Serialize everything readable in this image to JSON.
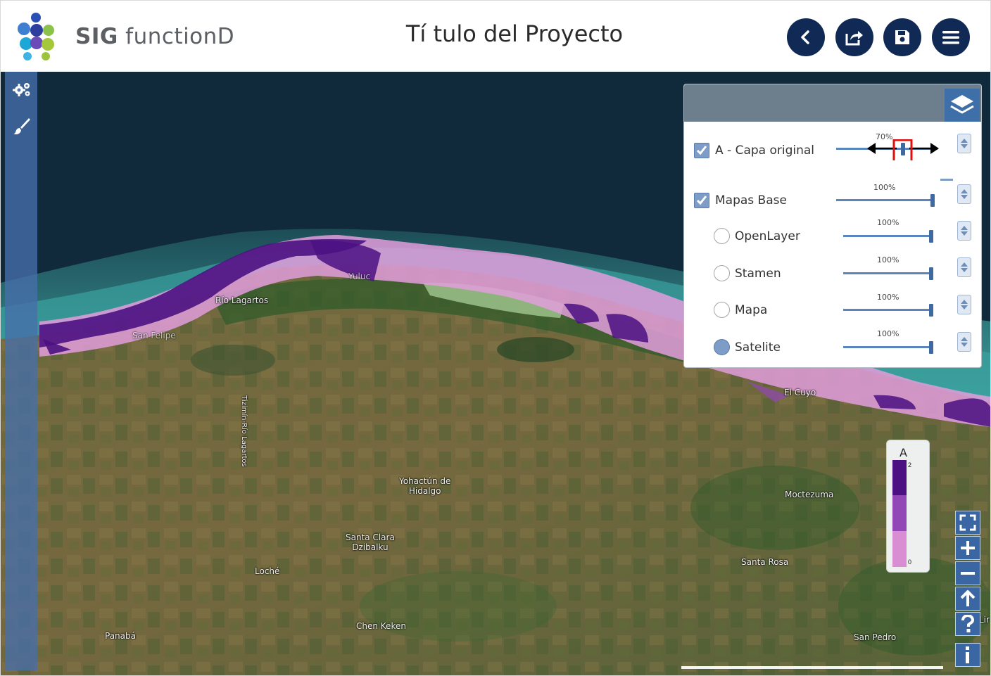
{
  "header": {
    "brand_bold": "SIG",
    "brand_rest": " functionD",
    "title": "Tí tulo del Proyecto",
    "buttons": [
      "back-icon",
      "share-icon",
      "save-icon",
      "menu-icon"
    ]
  },
  "toolbar": {
    "icons": [
      "settings-gears-icon",
      "brush-icon"
    ]
  },
  "places": {
    "rio_lagartos": "Río Lagartos",
    "san_felipe": "San Felipe",
    "yuluc": "Yuluc",
    "tizimin": "Tizimín-Río Lagartos",
    "el_cuyo": "El Cuyo",
    "yohactun": "Yohactún de\nHidalgo",
    "santa_clara": "Santa Clara\nDzibalku",
    "loche": "Loché",
    "chen_keken": "Chen Keken",
    "panaba": "Panabá",
    "moctezuma": "Moctezuma",
    "santa_rosa": "Santa Rosa",
    "san_pedro": "San Pedro",
    "lir": "Lir"
  },
  "layer_panel": {
    "layers": [
      {
        "label": "A - Capa original",
        "checked": true,
        "opacity": 70,
        "opacity_label": "70%"
      },
      {
        "label": "Mapas Base",
        "checked": true,
        "opacity": 100,
        "opacity_label": "100%"
      }
    ],
    "base_maps": [
      {
        "label": "OpenLayer",
        "selected": false,
        "opacity": 100,
        "opacity_label": "100%"
      },
      {
        "label": "Stamen",
        "selected": false,
        "opacity": 100,
        "opacity_label": "100%"
      },
      {
        "label": "Mapa",
        "selected": false,
        "opacity": 100,
        "opacity_label": "100%"
      },
      {
        "label": "Satelite",
        "selected": true,
        "opacity": 100,
        "opacity_label": "100%"
      }
    ]
  },
  "legend": {
    "title": "A",
    "max_label": "2",
    "min_label": "0",
    "colors": [
      "#4b1182",
      "#9147b5",
      "#d98ed3"
    ]
  },
  "map_controls": [
    "fullscreen-icon",
    "zoom-in-icon",
    "zoom-out-icon",
    "north-arrow-icon",
    "help-icon",
    "info-icon"
  ],
  "colors": {
    "header_button": "#112a55",
    "accent": "#3a66a3",
    "class_high": "#4b1182",
    "class_low": "#e29ddc"
  }
}
